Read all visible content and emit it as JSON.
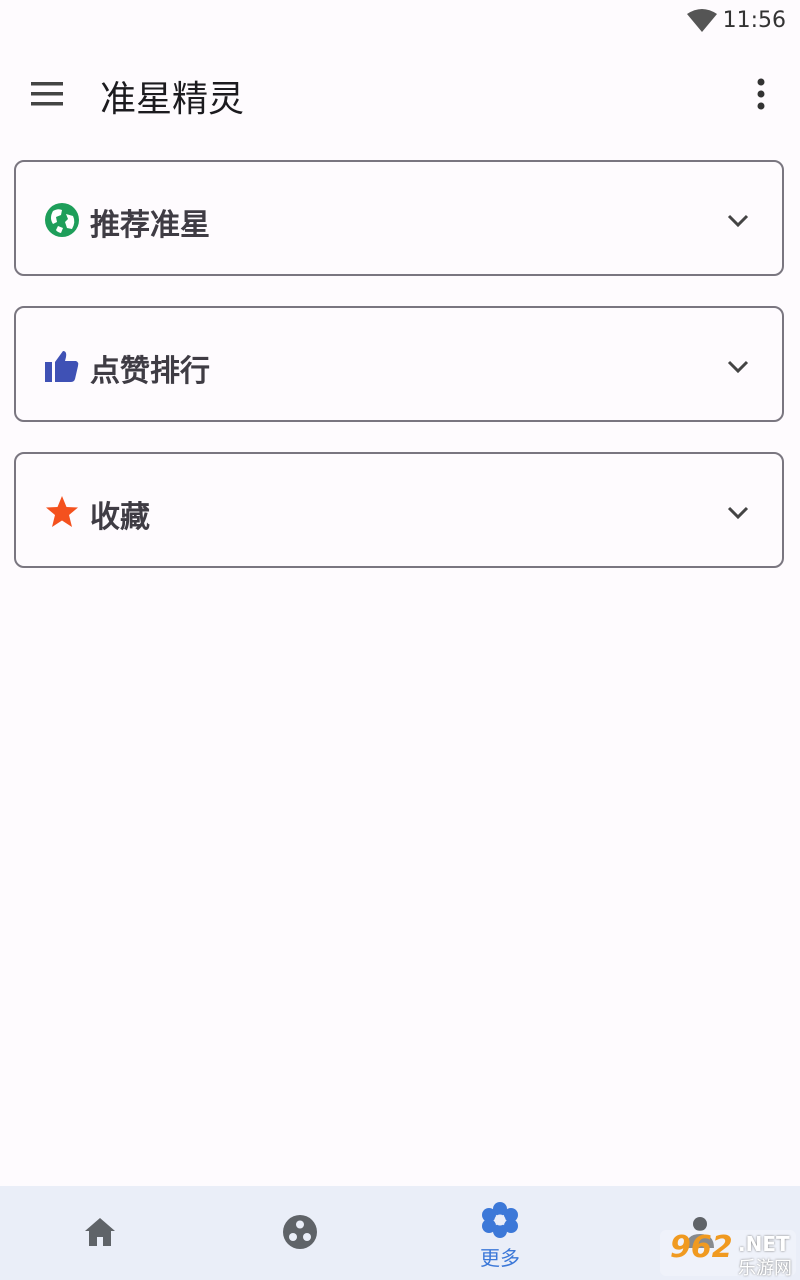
{
  "status_bar": {
    "time": "11:56",
    "wifi_icon": "wifi-icon"
  },
  "app_bar": {
    "title": "准星精灵",
    "menu_icon": "menu-icon",
    "more_icon": "more-vert-icon"
  },
  "cards": [
    {
      "label": "推荐准星",
      "icon": "globe-icon",
      "icon_color": "#1e9e5a"
    },
    {
      "label": "点赞排行",
      "icon": "thumb-up-icon",
      "icon_color": "#3f51b5"
    },
    {
      "label": "收藏",
      "icon": "star-icon",
      "icon_color": "#f4511e"
    }
  ],
  "bottom_nav": {
    "items": [
      {
        "icon": "home-icon",
        "label": ""
      },
      {
        "icon": "community-icon",
        "label": ""
      },
      {
        "icon": "flower-icon",
        "label": "更多",
        "active": true
      },
      {
        "icon": "person-icon",
        "label": ""
      }
    ],
    "active_color": "#3c78d8",
    "inactive_color": "#5f6368"
  },
  "watermark": {
    "brand": "962",
    "suffix": ".NET",
    "site": "乐游网"
  }
}
